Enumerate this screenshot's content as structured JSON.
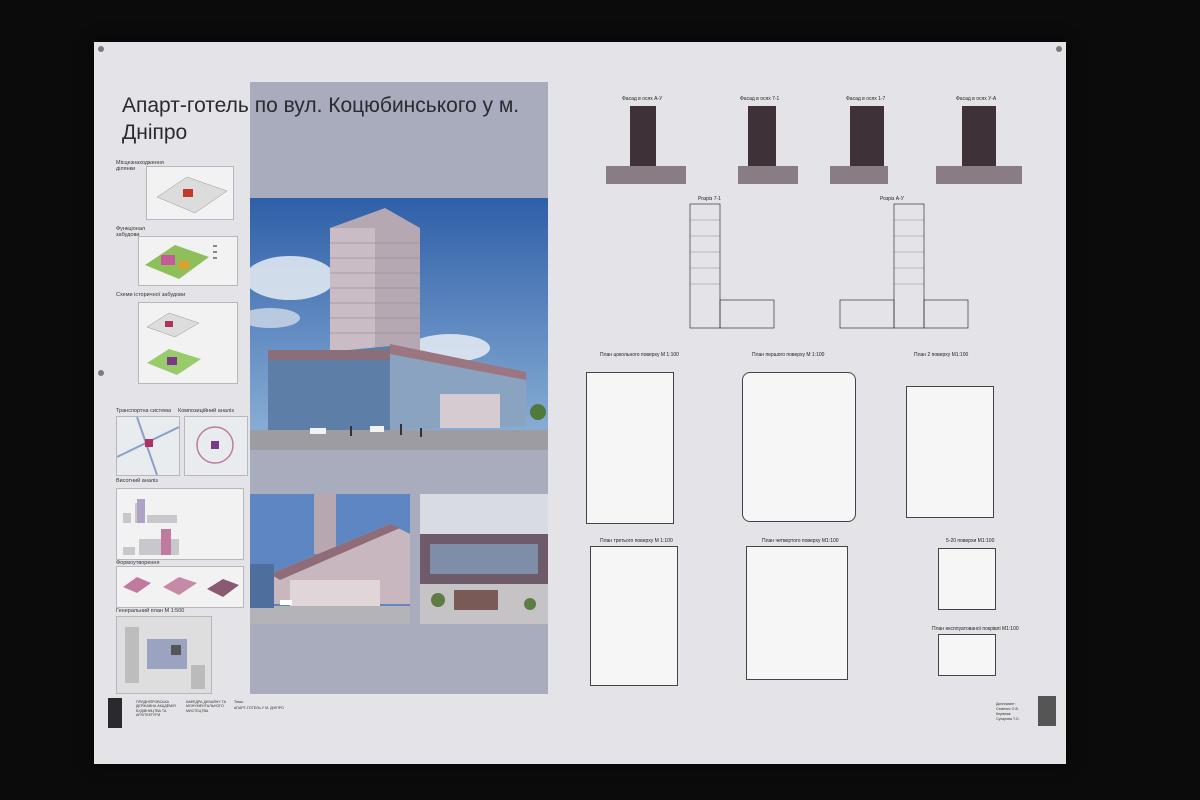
{
  "poster": {
    "title": "Апарт-готель по вул. Коцюбинського у м. Дніпро",
    "diagrams": [
      "Місцезнаходження ділянки",
      "Функціонал забудови",
      "Схеми історичної забудови",
      "Транспортна система",
      "Композиційний аналіз",
      "Висотний аналіз",
      "Формоутворення",
      "Генеральний план М 1:500"
    ],
    "facades": [
      "Фасад в осях А-У",
      "Фасад в осях 7-1",
      "Фасад в осях 1-7",
      "Фасад в осях У-А"
    ],
    "sections": [
      "Розріз 7-1",
      "Розріз А-У"
    ],
    "plans": [
      "План цокольного поверху М 1:100",
      "План першого поверху М 1:100",
      "План 2 поверху М1:100",
      "План третього поверху М 1:100",
      "План четвертого поверху М1:100",
      "5-20 поверхи М1:100",
      "План експлуатованої покрівлі М1:100"
    ],
    "footer": {
      "institution": "ПРИДНІПРОВСЬКА ДЕРЖАВНА АКАДЕМІЯ БУДІВНИЦТВА ТА АРХІТЕКТУРИ",
      "department": "КАФЕДРА ДИЗАЙНУ ТА МОНУМЕНТАЛЬНОГО МИСТЕЦТВА",
      "project_label": "Тема:",
      "project": "АПАРТ-ГОТЕЛЬ У М. ДНІПРО",
      "authors_label": "Дипломант:",
      "author": "Семенко О.В.",
      "supervisor_label": "Керівник:",
      "supervisor": "Сухарова Т.О."
    },
    "colors": {
      "background": "#0b0b0b",
      "poster": "#e4e4e8",
      "band": "#a9acbd",
      "sky": "#3f6fb8",
      "building": "#b9a9b2"
    }
  }
}
